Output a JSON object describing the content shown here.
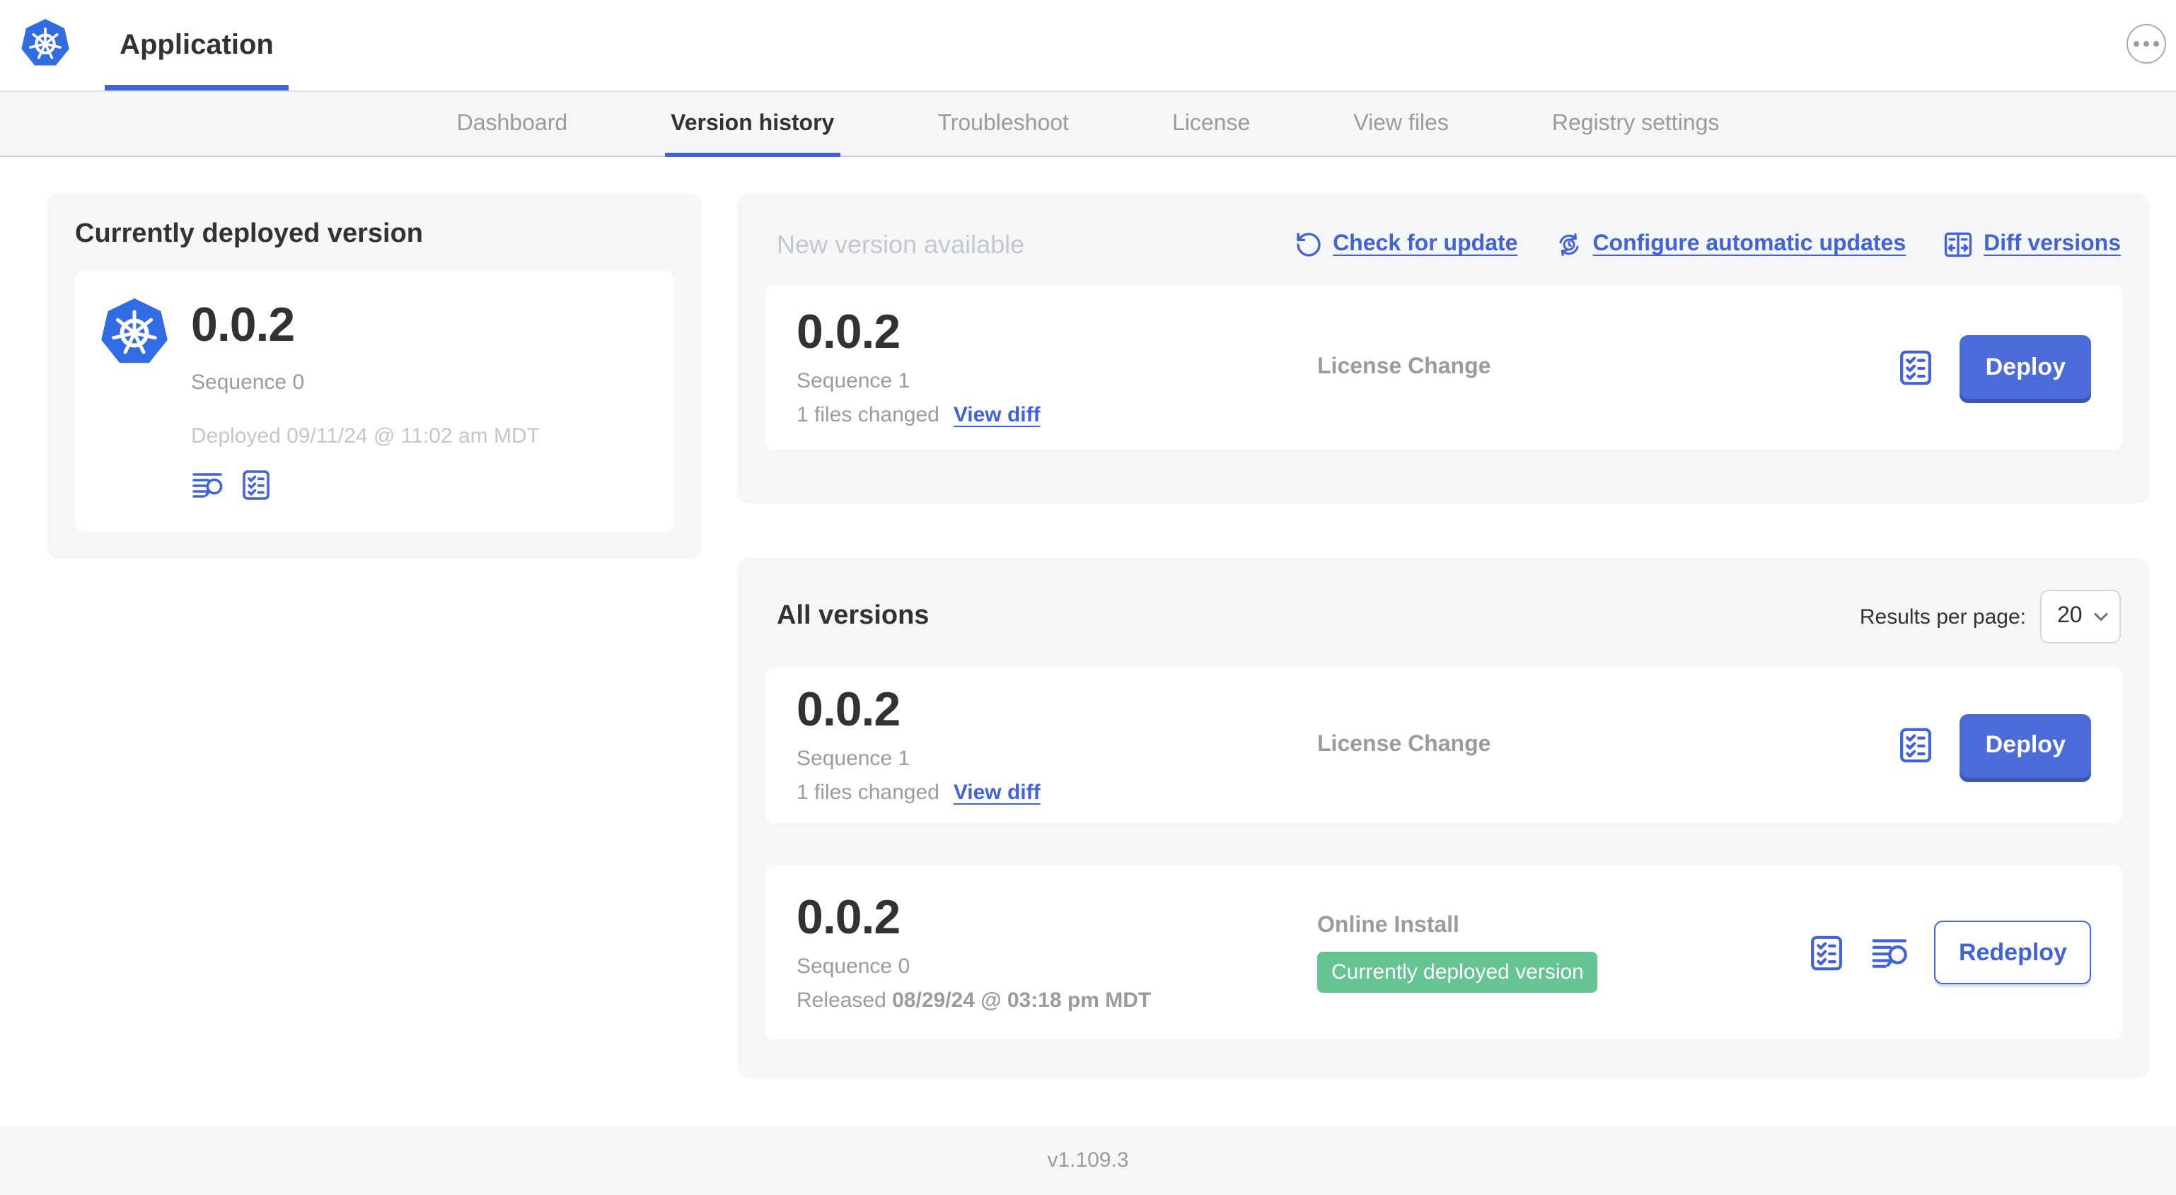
{
  "header": {
    "app_tab": "Application"
  },
  "nav": {
    "active_tab": "Version history",
    "tabs": [
      {
        "label": "Dashboard"
      },
      {
        "label": "Version history"
      },
      {
        "label": "Troubleshoot"
      },
      {
        "label": "License"
      },
      {
        "label": "View files"
      },
      {
        "label": "Registry settings"
      }
    ]
  },
  "current_version": {
    "title": "Currently deployed version",
    "version": "0.0.2",
    "sequence": "Sequence 0",
    "deployed": "Deployed 09/11/24 @ 11:02 am MDT"
  },
  "new_version": {
    "title": "New version available",
    "check_for_update": "Check for update",
    "configure_automatic_updates": "Configure automatic updates",
    "diff_versions": "Diff versions",
    "card": {
      "version": "0.0.2",
      "sequence": "Sequence 1",
      "files_changed": "1 files changed",
      "view_diff": "View diff",
      "source": "License Change",
      "deploy": "Deploy"
    }
  },
  "all_versions": {
    "title": "All versions",
    "results_per_page_label": "Results per page:",
    "results_per_page": "20",
    "rows": [
      {
        "version": "0.0.2",
        "sequence": "Sequence 1",
        "files_changed": "1 files changed",
        "view_diff": "View diff",
        "source": "License Change",
        "action": "Deploy"
      },
      {
        "version": "0.0.2",
        "sequence": "Sequence 0",
        "released_label": "Released",
        "released_date": "08/29/24 @ 03:18 pm MDT",
        "source": "Online Install",
        "badge": "Currently deployed version",
        "action": "Redeploy"
      }
    ]
  },
  "footer": {
    "console_version": "v1.109.3"
  },
  "colors": {
    "accent": "#4263d8",
    "button_primary": "#4a6bd8",
    "badge_green": "#65c492",
    "k8s_blue": "#326ce5"
  }
}
